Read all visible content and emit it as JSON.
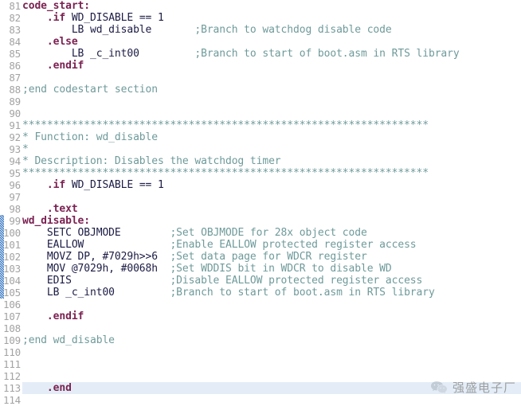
{
  "editor": {
    "name": "assembly-source-editor",
    "language": "TI C2000 assembly",
    "first_visible_line": 81,
    "last_visible_line": 114,
    "current_line": 113,
    "colors": {
      "background": "#ffffff",
      "line_number": "#a3a3a3",
      "label": "#7b2252",
      "directive": "#7b2252",
      "plain": "#1b1b45",
      "comment": "#6f9a9a",
      "current_line_highlight": "#e4edf7",
      "change_marker": "#2d6fbe"
    },
    "change_marker": {
      "name": "modified-lines-marker",
      "from_line": 99,
      "to_line": 105
    }
  },
  "lines": [
    {
      "num": "81",
      "current": false,
      "tokens": [
        {
          "t": "code_start:",
          "c": "label"
        }
      ]
    },
    {
      "num": "82",
      "current": false,
      "tokens": [
        {
          "t": "    ",
          "c": "plain"
        },
        {
          "t": ".if",
          "c": "directive"
        },
        {
          "t": " WD_DISABLE == 1",
          "c": "plain"
        }
      ]
    },
    {
      "num": "83",
      "current": false,
      "tokens": [
        {
          "t": "        LB wd_disable       ",
          "c": "plain"
        },
        {
          "t": ";Branch to watchdog disable code",
          "c": "comment"
        }
      ]
    },
    {
      "num": "84",
      "current": false,
      "tokens": [
        {
          "t": "    ",
          "c": "plain"
        },
        {
          "t": ".else",
          "c": "directive"
        }
      ]
    },
    {
      "num": "85",
      "current": false,
      "tokens": [
        {
          "t": "        LB _c_int00         ",
          "c": "plain"
        },
        {
          "t": ";Branch to start of boot.asm in RTS library",
          "c": "comment"
        }
      ]
    },
    {
      "num": "86",
      "current": false,
      "tokens": [
        {
          "t": "    ",
          "c": "plain"
        },
        {
          "t": ".endif",
          "c": "directive"
        }
      ]
    },
    {
      "num": "87",
      "current": false,
      "tokens": []
    },
    {
      "num": "88",
      "current": false,
      "tokens": [
        {
          "t": ";end codestart section",
          "c": "comment"
        }
      ]
    },
    {
      "num": "89",
      "current": false,
      "tokens": []
    },
    {
      "num": "90",
      "current": false,
      "tokens": []
    },
    {
      "num": "91",
      "current": false,
      "tokens": [
        {
          "t": "******************************************************************",
          "c": "comment"
        }
      ]
    },
    {
      "num": "92",
      "current": false,
      "tokens": [
        {
          "t": "* Function: wd_disable",
          "c": "comment"
        }
      ]
    },
    {
      "num": "93",
      "current": false,
      "tokens": [
        {
          "t": "*",
          "c": "comment"
        }
      ]
    },
    {
      "num": "94",
      "current": false,
      "tokens": [
        {
          "t": "* Description: Disables the watchdog timer",
          "c": "comment"
        }
      ]
    },
    {
      "num": "95",
      "current": false,
      "tokens": [
        {
          "t": "******************************************************************",
          "c": "comment"
        }
      ]
    },
    {
      "num": "96",
      "current": false,
      "tokens": [
        {
          "t": "    ",
          "c": "plain"
        },
        {
          "t": ".if",
          "c": "directive"
        },
        {
          "t": " WD_DISABLE == 1",
          "c": "plain"
        }
      ]
    },
    {
      "num": "97",
      "current": false,
      "tokens": []
    },
    {
      "num": "98",
      "current": false,
      "tokens": [
        {
          "t": "    ",
          "c": "plain"
        },
        {
          "t": ".text",
          "c": "directive"
        }
      ]
    },
    {
      "num": "99",
      "current": false,
      "tokens": [
        {
          "t": "wd_disable:",
          "c": "label"
        }
      ]
    },
    {
      "num": "100",
      "current": false,
      "tokens": [
        {
          "t": "    SETC OBJMODE        ",
          "c": "plain"
        },
        {
          "t": ";Set OBJMODE for 28x object code",
          "c": "comment"
        }
      ]
    },
    {
      "num": "101",
      "current": false,
      "tokens": [
        {
          "t": "    EALLOW              ",
          "c": "plain"
        },
        {
          "t": ";Enable EALLOW protected register access",
          "c": "comment"
        }
      ]
    },
    {
      "num": "102",
      "current": false,
      "tokens": [
        {
          "t": "    MOVZ DP, #7029h>>6  ",
          "c": "plain"
        },
        {
          "t": ";Set data page for WDCR register",
          "c": "comment"
        }
      ]
    },
    {
      "num": "103",
      "current": false,
      "tokens": [
        {
          "t": "    MOV @7029h, #0068h  ",
          "c": "plain"
        },
        {
          "t": ";Set WDDIS bit in WDCR to disable WD",
          "c": "comment"
        }
      ]
    },
    {
      "num": "104",
      "current": false,
      "tokens": [
        {
          "t": "    EDIS                ",
          "c": "plain"
        },
        {
          "t": ";Disable EALLOW protected register access",
          "c": "comment"
        }
      ]
    },
    {
      "num": "105",
      "current": false,
      "tokens": [
        {
          "t": "    LB _c_int00         ",
          "c": "plain"
        },
        {
          "t": ";Branch to start of boot.asm in RTS library",
          "c": "comment"
        }
      ]
    },
    {
      "num": "106",
      "current": false,
      "tokens": []
    },
    {
      "num": "107",
      "current": false,
      "tokens": [
        {
          "t": "    ",
          "c": "plain"
        },
        {
          "t": ".endif",
          "c": "directive"
        }
      ]
    },
    {
      "num": "108",
      "current": false,
      "tokens": []
    },
    {
      "num": "109",
      "current": false,
      "tokens": [
        {
          "t": ";end wd_disable",
          "c": "comment"
        }
      ]
    },
    {
      "num": "110",
      "current": false,
      "tokens": []
    },
    {
      "num": "111",
      "current": false,
      "tokens": []
    },
    {
      "num": "112",
      "current": false,
      "tokens": []
    },
    {
      "num": "113",
      "current": true,
      "tokens": [
        {
          "t": "    ",
          "c": "plain"
        },
        {
          "t": ".end",
          "c": "directive"
        }
      ]
    },
    {
      "num": "114",
      "current": false,
      "tokens": []
    }
  ],
  "watermark": {
    "icon": "wechat-logo-icon",
    "text": "强盛电子厂"
  }
}
